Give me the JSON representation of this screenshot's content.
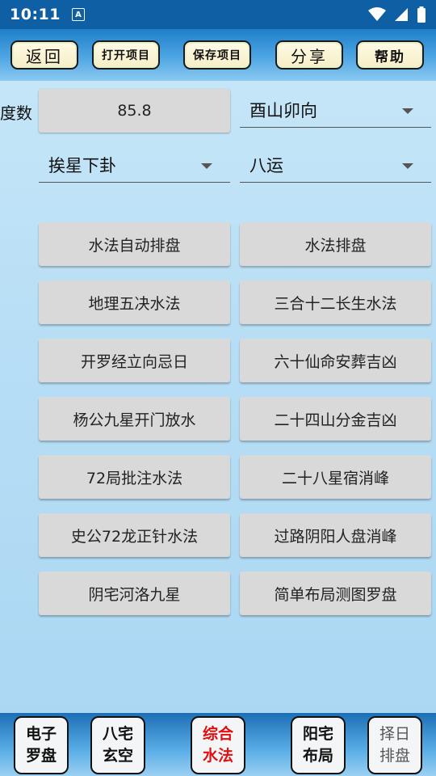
{
  "status": {
    "time": "10:11",
    "notification_letter": "A"
  },
  "toolbar": {
    "back": "返回",
    "open": "打开项目",
    "save": "保存项目",
    "share": "分享",
    "help": "帮助"
  },
  "form": {
    "degree_label": "度数",
    "degree_value": "85.8",
    "direction": "酉山卯向",
    "method": "挨星下卦",
    "period": "八运"
  },
  "grid": {
    "b0": "水法自动排盘",
    "b1": "水法排盘",
    "b2": "地理五决水法",
    "b3": "三合十二长生水法",
    "b4": "开罗经立向忌日",
    "b5": "六十仙命安葬吉凶",
    "b6": "杨公九星开门放水",
    "b7": "二十四山分金吉凶",
    "b8": "72局批注水法",
    "b9": "二十八星宿消峰",
    "b10": "史公72龙正针水法",
    "b11": "过路阴阳人盘消峰",
    "b12": "阴宅河洛九星",
    "b13": "简单布局测图罗盘"
  },
  "bottom_nav": {
    "compass": "电子罗盘",
    "bazhai": "八宅玄空",
    "water": "综合水法",
    "yangzhai": "阳宅布局",
    "zeri": "择日排盘",
    "active_color": "#e01010"
  }
}
